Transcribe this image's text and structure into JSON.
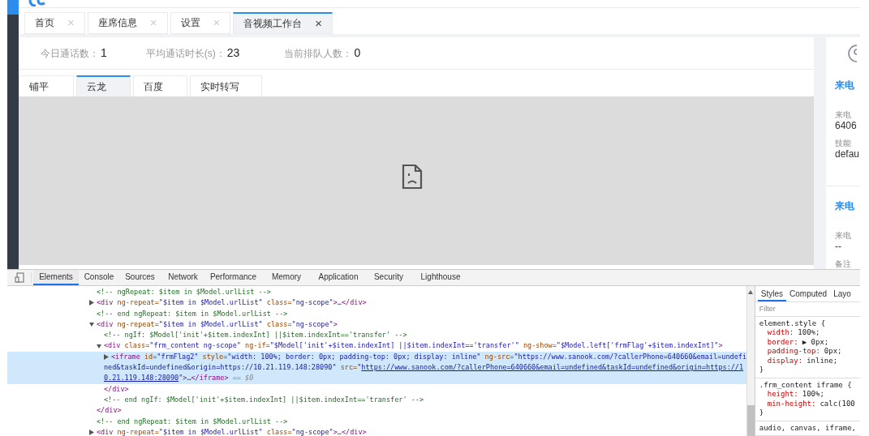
{
  "page_tabs": [
    {
      "label": "首页",
      "close": "×",
      "selected": false
    },
    {
      "label": "座席信息",
      "close": "×",
      "selected": false
    },
    {
      "label": "设置",
      "close": "×",
      "selected": false
    },
    {
      "label": "音视频工作台",
      "close": "×",
      "selected": true
    }
  ],
  "stats": [
    {
      "label": "今日通话数：",
      "value": "1"
    },
    {
      "label": "平均通话时长(s)：",
      "value": "23"
    },
    {
      "label": "当前排队人数：",
      "value": "0"
    }
  ],
  "sub_tabs": [
    {
      "label": "铺平",
      "selected": false
    },
    {
      "label": "云龙",
      "selected": true
    },
    {
      "label": "百度",
      "selected": false
    },
    {
      "label": "实时转写",
      "selected": false
    }
  ],
  "side_panel": [
    {
      "kind": "heading",
      "text": "来电"
    },
    {
      "kind": "label",
      "text": "来电"
    },
    {
      "kind": "value",
      "text": "6406"
    },
    {
      "kind": "label",
      "text": "技能"
    },
    {
      "kind": "value",
      "text": "defau"
    },
    {
      "kind": "divider"
    },
    {
      "kind": "heading",
      "text": "来电"
    },
    {
      "kind": "label",
      "text": "来电"
    },
    {
      "kind": "value",
      "text": "--"
    },
    {
      "kind": "label",
      "text": "备注"
    }
  ],
  "devtools": {
    "tabs": [
      {
        "label": "Elements",
        "selected": true
      },
      {
        "label": "Console",
        "selected": false
      },
      {
        "label": "Sources",
        "selected": false
      },
      {
        "label": "Network",
        "selected": false
      },
      {
        "label": "Performance",
        "selected": false
      },
      {
        "label": "Memory",
        "selected": false
      },
      {
        "label": "Application",
        "selected": false
      },
      {
        "label": "Security",
        "selected": false
      },
      {
        "label": "Lighthouse",
        "selected": false
      }
    ],
    "tree": [
      {
        "selected": false,
        "lines": [
          [
            {
              "kind": "comment",
              "text": "<!-- ngRepeat: $item in $Model.urlList -->"
            }
          ]
        ]
      },
      {
        "selected": false,
        "expanded": false,
        "lines": [
          [
            {
              "kind": "markup",
              "text": "<div ng-repeat=\"$item in $Model.urlList\" class=\"ng-scope\">…</div>"
            }
          ]
        ]
      },
      {
        "selected": false,
        "lines": [
          [
            {
              "kind": "comment",
              "text": "<!-- end ngRepeat: $item in $Model.urlList -->"
            }
          ]
        ]
      },
      {
        "selected": false,
        "expanded": true,
        "lines": [
          [
            {
              "kind": "markup",
              "text": "<div ng-repeat=\"$item in $Model.urlList\" class=\"ng-scope\">"
            }
          ]
        ],
        "children": [
          {
            "selected": false,
            "lines": [
              [
                {
                  "kind": "comment",
                  "text": "<!-- ngIf: $Model['init'+$item.indexInt] ||$item.indexInt=='transfer' -->"
                }
              ]
            ]
          },
          {
            "selected": false,
            "expanded": true,
            "lines": [
              [
                {
                  "kind": "markup",
                  "text": "<div class=\"frm_content ng-scope\" ng-if=\"$Model['init'+$item.indexInt] ||$item.indexInt=='transfer'\" ng-show=\"$Model.left['frmFlag'+$item.indexInt]\">"
                }
              ]
            ],
            "children": [
              {
                "selected": true,
                "expanded": false,
                "lines": [
                  [
                    {
                      "kind": "markup",
                      "text": "<iframe id=\"frmFlag2\" style=\"width: 100%; border: 0px; padding-top: 0px; display: inline\" ng-src=\"https://www.sanook.com/?callerPhone=640660&email=undefi"
                    }
                  ],
                  [
                    {
                      "kind": "value",
                      "text": "ned&taskId=undefined&origin=https://10.21.119.148:28090\""
                    },
                    {
                      "kind": "markup",
                      "text": " src=\""
                    },
                    {
                      "kind": "link",
                      "text": "https://www.sanook.com/?callerPhone=640660&email=undefined&taskId=undefined&origin=https://1"
                    }
                  ],
                  [
                    {
                      "kind": "link",
                      "text": "0.21.119.148:28090"
                    },
                    {
                      "kind": "value",
                      "text": "\""
                    },
                    {
                      "kind": "markup",
                      "text": ">…</iframe>"
                    },
                    {
                      "kind": "note",
                      "text": " == $0"
                    }
                  ]
                ]
              }
            ],
            "close": [
              {
                "kind": "markup",
                "text": "</div>"
              }
            ]
          },
          {
            "selected": false,
            "lines": [
              [
                {
                  "kind": "comment",
                  "text": "<!-- end ngIf: $Model['init'+$item.indexInt] ||$item.indexInt=='transfer' -->"
                }
              ]
            ]
          }
        ],
        "close": [
          {
            "kind": "markup",
            "text": "</div>"
          }
        ]
      },
      {
        "selected": false,
        "lines": [
          [
            {
              "kind": "comment",
              "text": "<!-- end ngRepeat: $item in $Model.urlList -->"
            }
          ]
        ]
      },
      {
        "selected": false,
        "expanded": false,
        "lines": [
          [
            {
              "kind": "markup",
              "text": "<div ng-repeat=\"$item in $Model.urlList\" class=\"ng-scope\">…</div>"
            }
          ]
        ]
      }
    ],
    "styles_tabs": [
      {
        "label": "Styles",
        "selected": true
      },
      {
        "label": "Computed",
        "selected": false
      },
      {
        "label": "Layo",
        "selected": false
      }
    ],
    "filter": {
      "placeholder": "Filter"
    },
    "rules": [
      {
        "selector": "element.style {",
        "props": [
          {
            "name": "width:",
            "value": "100%;"
          },
          {
            "name": "border:",
            "value": "▶ 0px;"
          },
          {
            "name": "padding-top:",
            "value": "0px;"
          },
          {
            "name": "display:",
            "value": "inline;"
          }
        ],
        "end": "}"
      },
      {
        "selector": ".frm_content iframe {",
        "props": [
          {
            "name": "height:",
            "value": "100%;"
          },
          {
            "name": "min-height:",
            "value": "calc(100"
          }
        ],
        "end": "}"
      },
      {
        "selector": "audio, canvas, iframe,"
      }
    ]
  }
}
